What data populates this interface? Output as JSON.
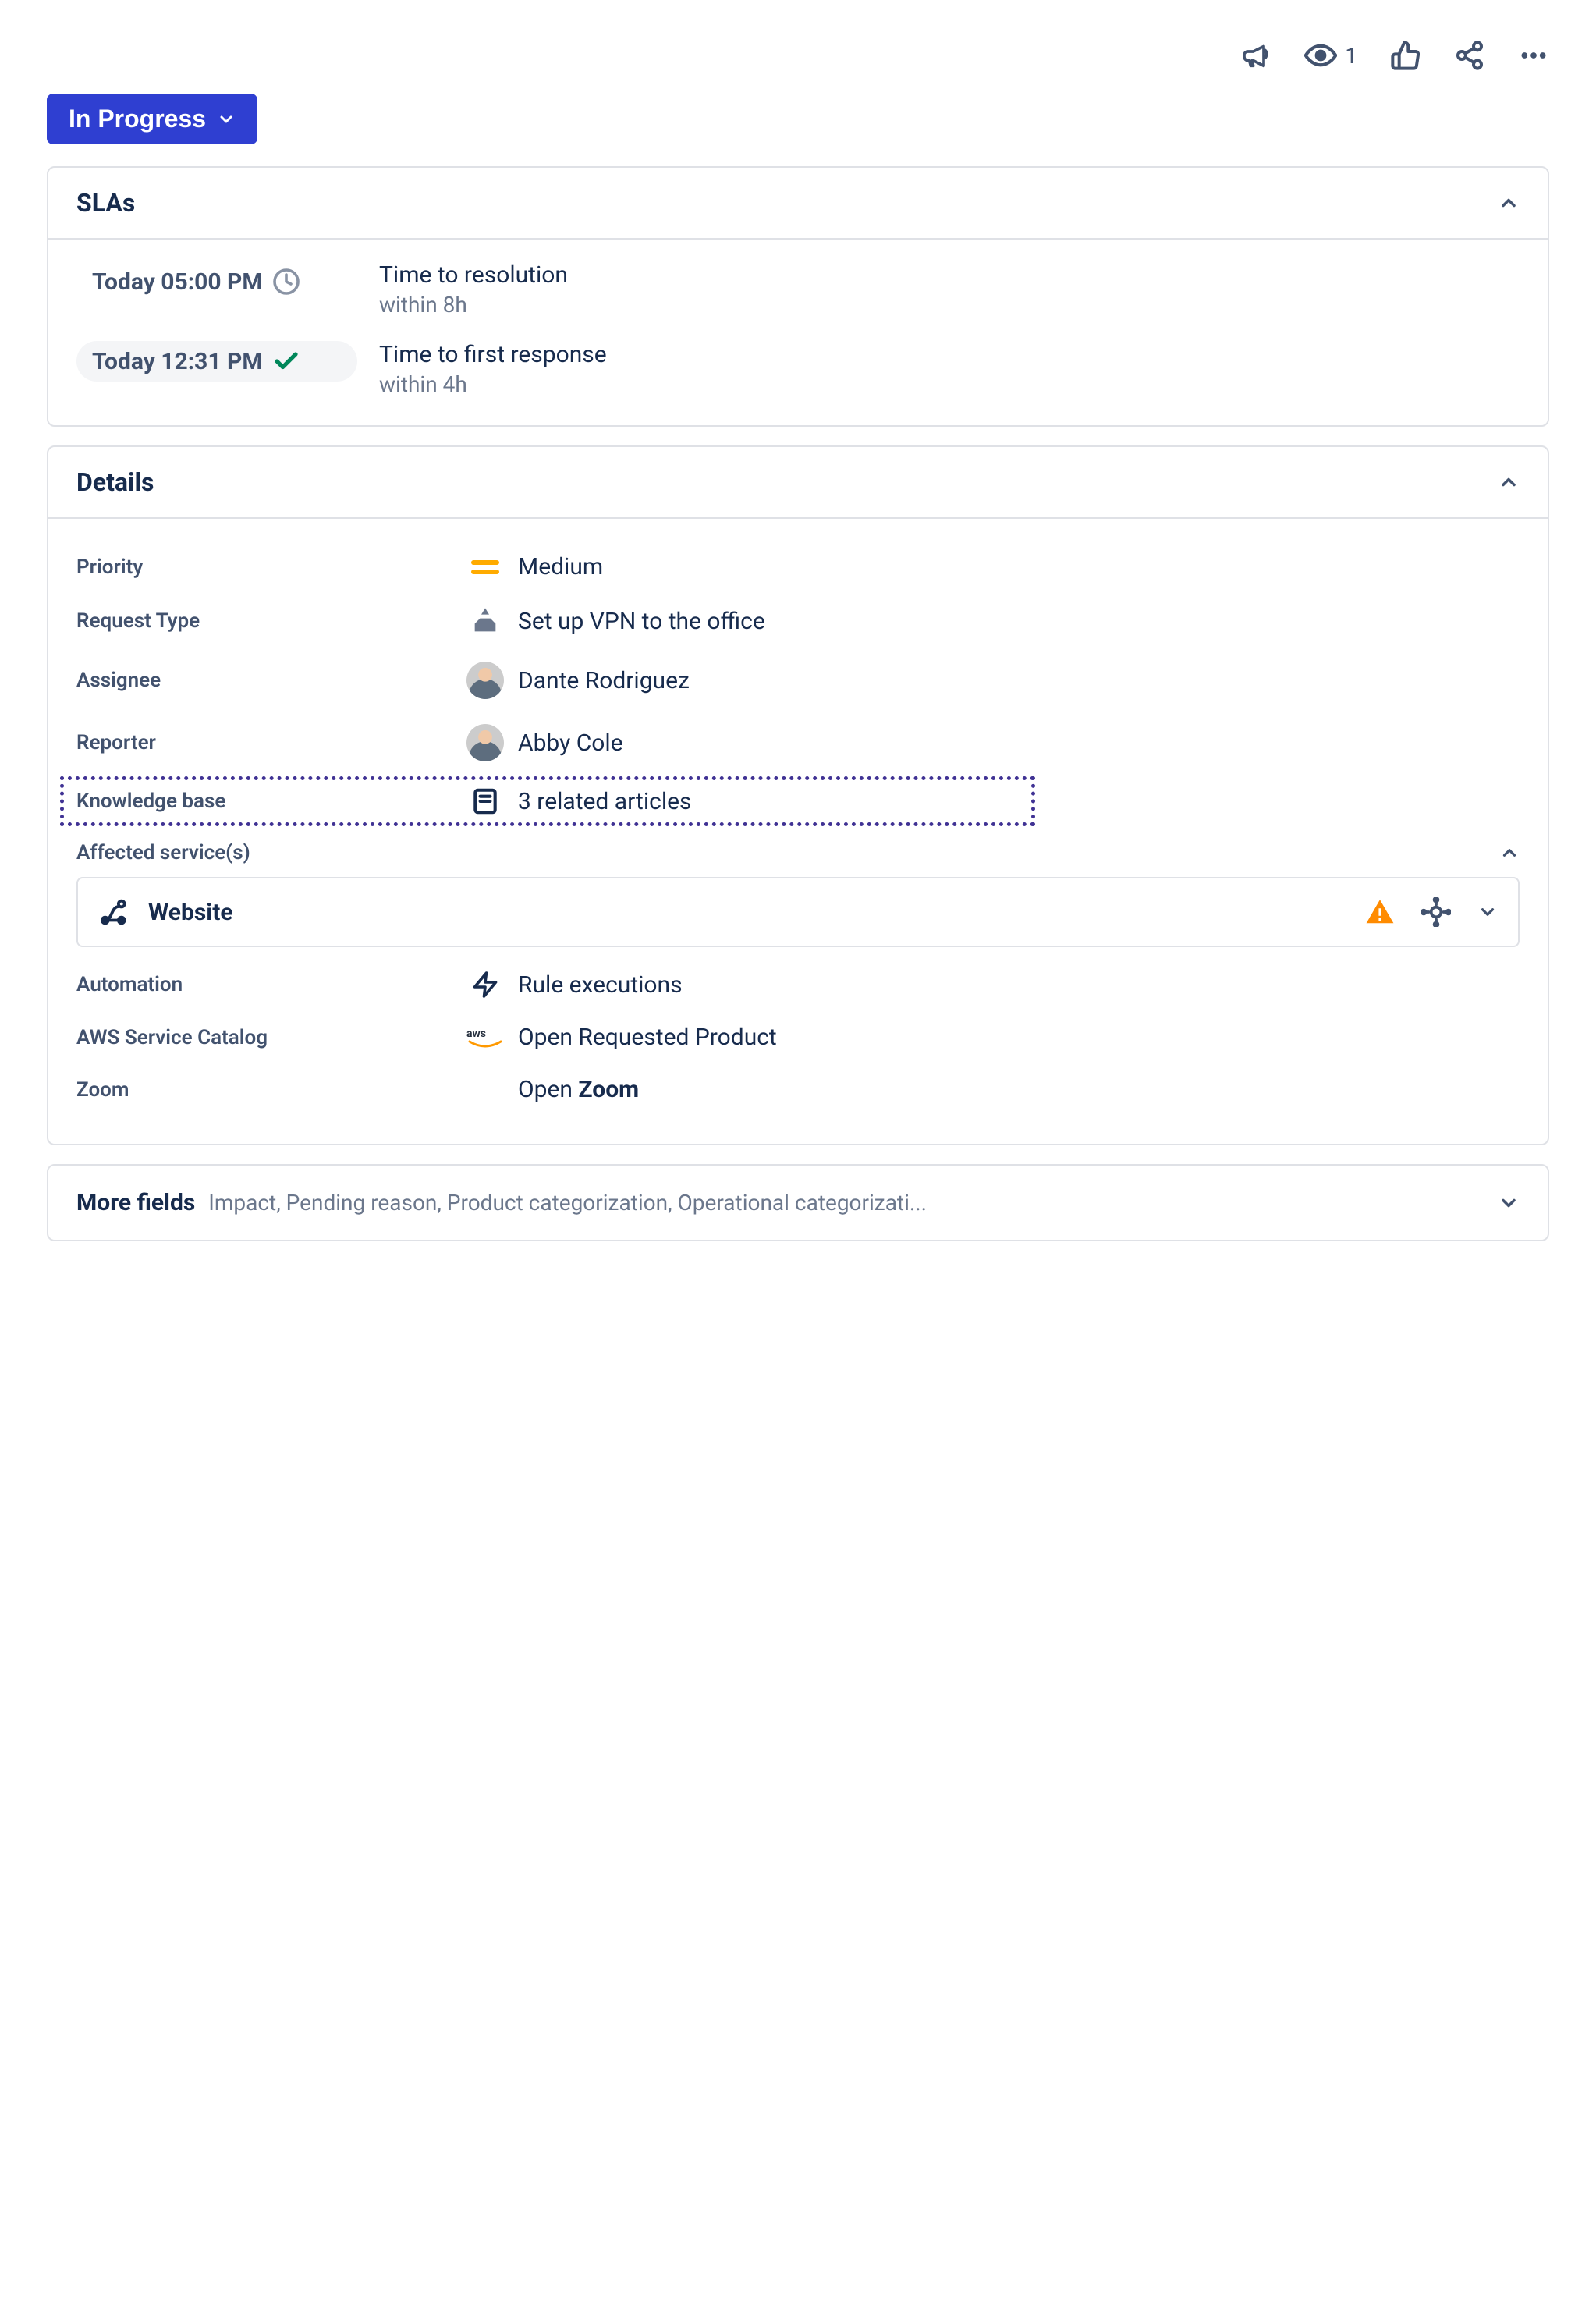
{
  "toolbar": {
    "watch_count": "1"
  },
  "status": {
    "label": "In Progress"
  },
  "slas": {
    "title": "SLAs",
    "items": [
      {
        "time": "Today 05:00 PM",
        "status_icon": "clock",
        "title": "Time to resolution",
        "sub": "within 8h",
        "pill": false
      },
      {
        "time": "Today 12:31 PM",
        "status_icon": "check",
        "title": "Time to first response",
        "sub": "within 4h",
        "pill": true
      }
    ]
  },
  "details": {
    "title": "Details",
    "priority": {
      "label": "Priority",
      "value": "Medium"
    },
    "request_type": {
      "label": "Request Type",
      "value": "Set up VPN to the office"
    },
    "assignee": {
      "label": "Assignee",
      "value": "Dante Rodriguez"
    },
    "reporter": {
      "label": "Reporter",
      "value": "Abby Cole"
    },
    "knowledge_base": {
      "label": "Knowledge base",
      "value": "3 related articles"
    },
    "affected_services": {
      "label": "Affected service(s)",
      "items": [
        {
          "name": "Website"
        }
      ]
    },
    "automation": {
      "label": "Automation",
      "value": "Rule executions"
    },
    "aws": {
      "label": "AWS Service Catalog",
      "value": "Open Requested Product"
    },
    "zoom": {
      "label": "Zoom",
      "value_prefix": "Open ",
      "value_bold": "Zoom"
    }
  },
  "more_fields": {
    "label": "More fields",
    "sub": "Impact, Pending reason, Product categorization, Operational categorizati..."
  }
}
